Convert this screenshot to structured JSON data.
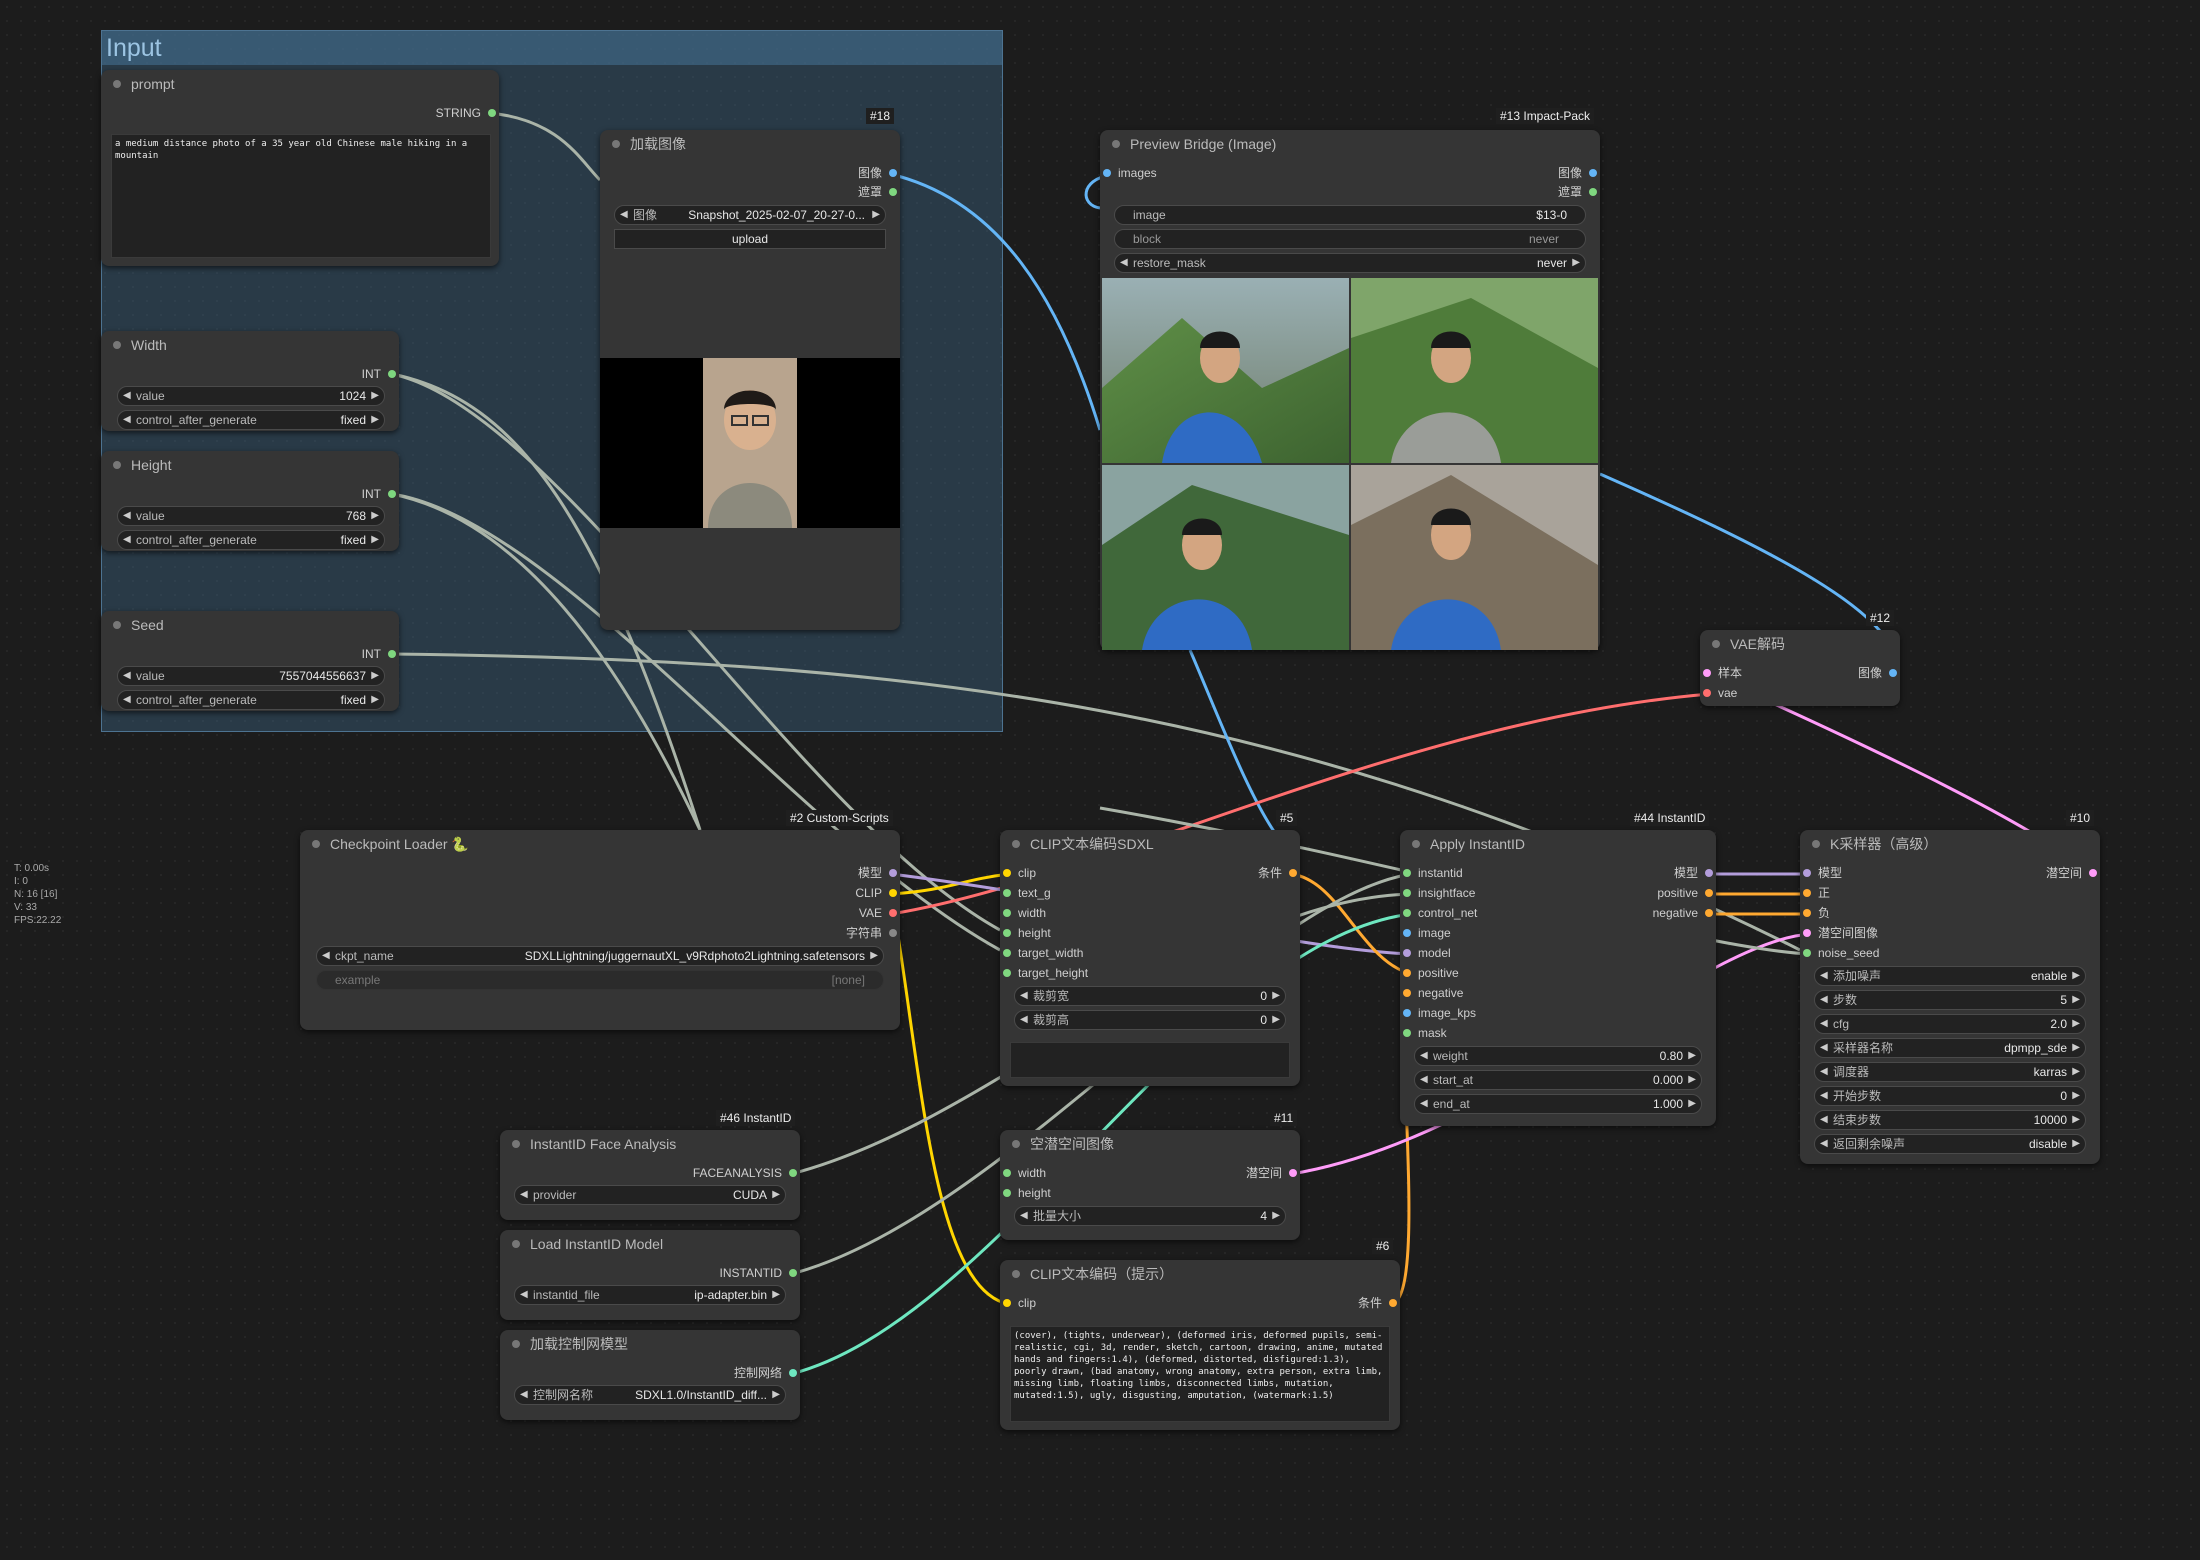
{
  "stats": {
    "t": "T: 0.00s",
    "i": "I: 0",
    "n": "N: 16 [16]",
    "v": "V: 33",
    "fps": "FPS:22.22"
  },
  "group": {
    "title": "Input"
  },
  "nodes": {
    "prompt": {
      "title": "prompt",
      "out": "STRING",
      "text": "a medium distance photo of a 35 year old Chinese male hiking in a mountain"
    },
    "width": {
      "title": "Width",
      "out": "INT",
      "value_label": "value",
      "value": "1024",
      "cag_label": "control_after_generate",
      "cag": "fixed"
    },
    "height": {
      "title": "Height",
      "out": "INT",
      "value_label": "value",
      "value": "768",
      "cag_label": "control_after_generate",
      "cag": "fixed"
    },
    "seed": {
      "title": "Seed",
      "out": "INT",
      "value_label": "value",
      "value": "7557044556637",
      "cag_label": "control_after_generate",
      "cag": "fixed"
    },
    "loadimg": {
      "badge": "#18",
      "title": "加载图像",
      "out1": "图像",
      "out2": "遮罩",
      "img_label": "图像",
      "img_value": "Snapshot_2025-02-07_20-27-0...",
      "upload": "upload"
    },
    "preview": {
      "badge": "#13 Impact-Pack",
      "title": "Preview Bridge (Image)",
      "in1": "images",
      "out1": "图像",
      "out2": "遮罩",
      "image_label": "image",
      "image_value": "$13-0",
      "block_label": "block",
      "block_value": "never",
      "restore_label": "restore_mask",
      "restore_value": "never"
    },
    "vae": {
      "badge": "#12",
      "title": "VAE解码",
      "in1": "样本",
      "in2": "vae",
      "out1": "图像"
    },
    "ckpt": {
      "badge": "#2 Custom-Scripts",
      "title": "Checkpoint Loader 🐍",
      "out1": "模型",
      "out2": "CLIP",
      "out3": "VAE",
      "out4": "字符串",
      "ckpt_label": "ckpt_name",
      "ckpt_value": "SDXLLightning/juggernautXL_v9Rdphoto2Lightning.safetensors",
      "example_label": "example",
      "example_value": "[none]"
    },
    "clipsdxl": {
      "badge": "#5",
      "title": "CLIP文本编码SDXL",
      "in1": "clip",
      "in2": "text_g",
      "in3": "width",
      "in4": "height",
      "in5": "target_width",
      "in6": "target_height",
      "out1": "条件",
      "crop_w_label": "裁剪宽",
      "crop_w": "0",
      "crop_h_label": "裁剪高",
      "crop_h": "0"
    },
    "applyid": {
      "badge": "#44 InstantID",
      "title": "Apply InstantID",
      "in1": "instantid",
      "in2": "insightface",
      "in3": "control_net",
      "in4": "image",
      "in5": "model",
      "in6": "positive",
      "in7": "negative",
      "in8": "image_kps",
      "in9": "mask",
      "out1": "模型",
      "out2": "positive",
      "out3": "negative",
      "weight_label": "weight",
      "weight": "0.80",
      "start_label": "start_at",
      "start": "0.000",
      "end_label": "end_at",
      "end": "1.000"
    },
    "ksampler": {
      "badge": "#10",
      "title": "K采样器（高级）",
      "in1": "模型",
      "in2": "正",
      "in3": "负",
      "in4": "潜空间图像",
      "in5": "noise_seed",
      "out1": "潜空间",
      "w": [
        [
          "添加噪声",
          "enable"
        ],
        [
          "步数",
          "5"
        ],
        [
          "cfg",
          "2.0"
        ],
        [
          "采样器名称",
          "dpmpp_sde"
        ],
        [
          "调度器",
          "karras"
        ],
        [
          "开始步数",
          "0"
        ],
        [
          "结束步数",
          "10000"
        ],
        [
          "返回剩余噪声",
          "disable"
        ]
      ]
    },
    "face": {
      "badge": "#46 InstantID",
      "title": "InstantID Face Analysis",
      "out1": "FACEANALYSIS",
      "provider_label": "provider",
      "provider": "CUDA"
    },
    "loadid": {
      "title": "Load InstantID Model",
      "out1": "INSTANTID",
      "file_label": "instantid_file",
      "file": "ip-adapter.bin"
    },
    "cnet": {
      "title": "加载控制网模型",
      "out1": "控制网络",
      "cn_label": "控制网名称",
      "cn": "SDXL1.0/InstantID_diff..."
    },
    "latent": {
      "badge": "#11",
      "title": "空潜空间图像",
      "in1": "width",
      "in2": "height",
      "out1": "潜空间",
      "batch_label": "批量大小",
      "batch": "4"
    },
    "clipneg": {
      "badge": "#6",
      "title": "CLIP文本编码（提示）",
      "in1": "clip",
      "out1": "条件",
      "text": "(cover), (tights, underwear), (deformed iris, deformed pupils, semi-realistic, cgi, 3d, render, sketch, cartoon, drawing, anime, mutated hands and fingers:1.4), (deformed, distorted, disfigured:1.3), poorly drawn, (bad anatomy, wrong anatomy, extra person, extra limb, missing limb, floating limbs, disconnected limbs, mutation, mutated:1.5), ugly, disgusting, amputation, (watermark:1.5)"
    }
  },
  "colors": {
    "model": "#b39ddb",
    "clip": "#ffd500",
    "vae": "#ff6e6e",
    "image": "#64b5f6",
    "int": "#aab4a8",
    "cond": "#ffa931",
    "latent": "#ff9cf9",
    "green": "#7fd77f",
    "cnet": "#6ee7c0"
  }
}
